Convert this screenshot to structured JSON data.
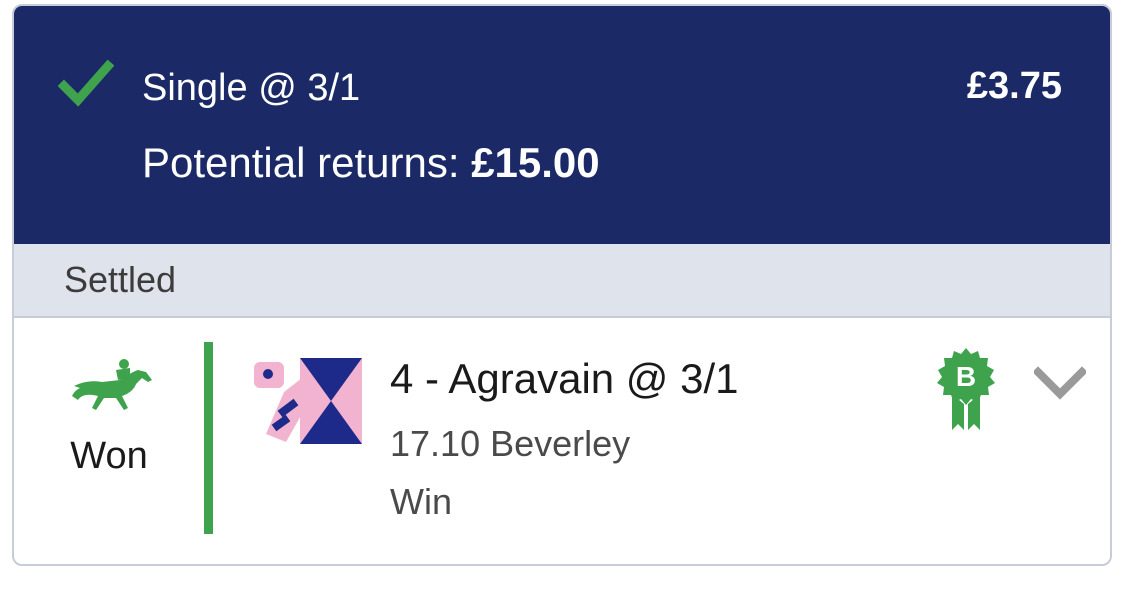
{
  "bet": {
    "type_label": "Single @ 3/1",
    "stake": "£3.75",
    "returns_label": "Potential returns:",
    "returns_amount": "£15.00",
    "status": "Settled"
  },
  "selection": {
    "result": "Won",
    "runner": "4 - Agravain @ 3/1",
    "race": "17.10 Beverley",
    "market": "Win",
    "badge_letter": "B"
  },
  "icons": {
    "check": "check-icon",
    "horse": "horse-racing-icon",
    "silks": "jockey-silks-icon",
    "badge": "best-odds-rosette-icon",
    "chevron": "chevron-down-icon"
  },
  "colors": {
    "header_bg": "#1b2a67",
    "status_bg": "#dfe3ec",
    "win_green": "#3fa34d",
    "silks_pink": "#f2b3d1",
    "silks_navy": "#1e2a8a",
    "chevron_gray": "#9a9a9a"
  }
}
